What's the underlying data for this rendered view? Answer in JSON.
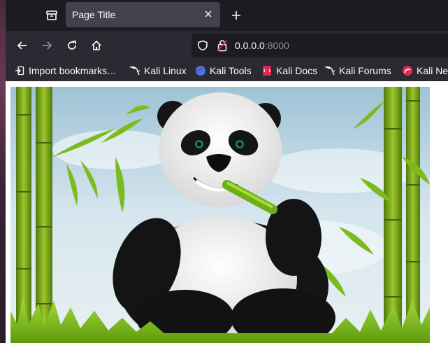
{
  "browser": {
    "tab": {
      "title": "Page Title"
    },
    "url": {
      "host": "0.0.0.0",
      "port": ":8000"
    },
    "bookmarks": [
      {
        "label": "Import bookmarks…",
        "icon": "import-icon"
      },
      {
        "label": "Kali Linux",
        "icon": "kali-dragon-icon"
      },
      {
        "label": "Kali Tools",
        "icon": "kali-tools-icon"
      },
      {
        "label": "Kali Docs",
        "icon": "kali-docs-icon"
      },
      {
        "label": "Kali Forums",
        "icon": "kali-dragon-icon"
      },
      {
        "label": "Kali Ne",
        "icon": "kali-nethunter-icon"
      }
    ]
  },
  "content": {
    "image": {
      "subject": "cartoon panda eating bamboo",
      "bg_sky": "#cfe3ee",
      "grass": "#7fc21c",
      "bamboo": "#7aa61a"
    }
  }
}
